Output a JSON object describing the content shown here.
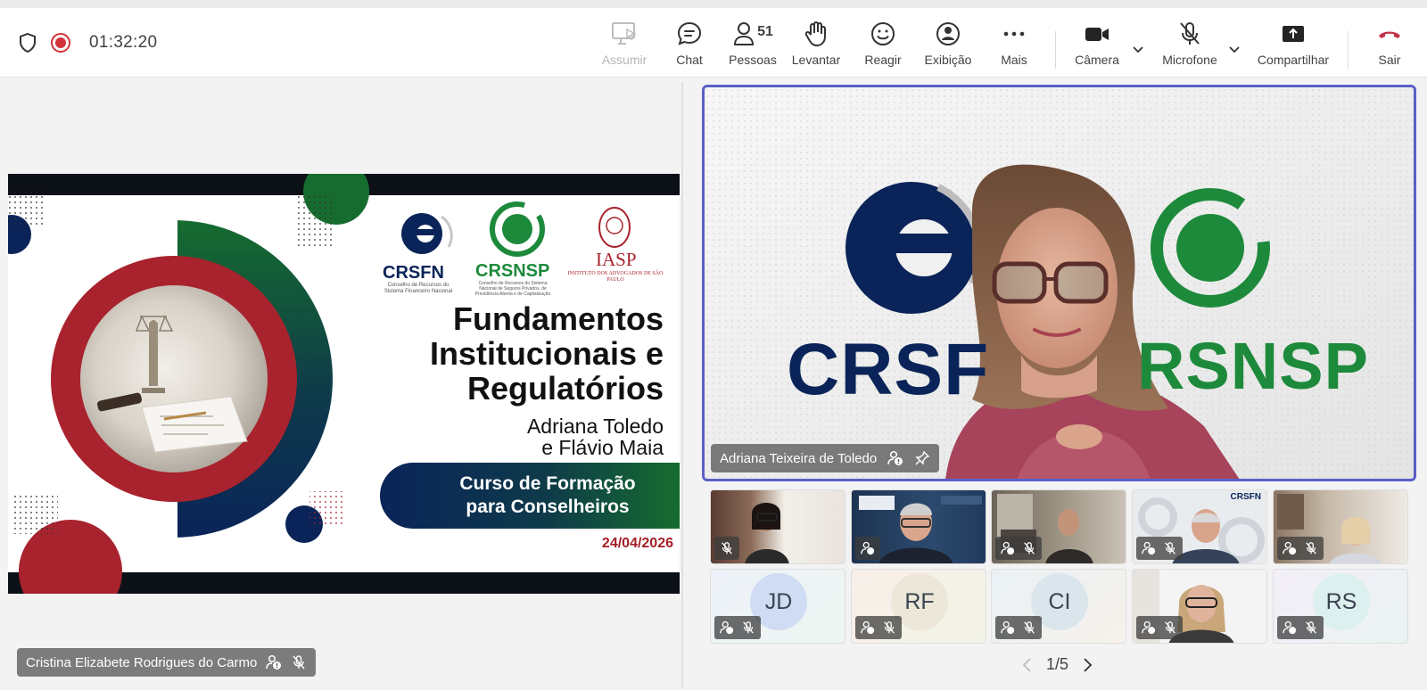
{
  "toolbar": {
    "timer": "01:32:20",
    "assumir": "Assumir",
    "chat": "Chat",
    "pessoas": "Pessoas",
    "pessoas_count": "51",
    "levantar": "Levantar",
    "reagir": "Reagir",
    "exibicao": "Exibição",
    "mais": "Mais",
    "camera": "Câmera",
    "microfone": "Microfone",
    "compartilhar": "Compartilhar",
    "sair": "Sair",
    "leave_color": "#c4314b",
    "record_color": "#d13438"
  },
  "slide": {
    "logo1": "CRSFN",
    "logo1_sub": "Conselho de Recursos do Sistema Financeiro Nacional",
    "logo2": "CRSNSP",
    "logo2_sub": "Conselho de Recursos do Sistema Nacional de Seguros Privados, de Previdência Aberta e de Capitalização",
    "logo3": "IASP",
    "logo3_sub": "INSTITUTO DOS ADVOGADOS DE SÃO PAULO",
    "title_line1": "Fundamentos",
    "title_line2": "Institucionais e",
    "title_line3": "Regulatórios",
    "authors_line1": "Adriana Toledo",
    "authors_line2": "e Flávio Maia",
    "course_line1": "Curso de Formação",
    "course_line2": "para Conselheiros",
    "date": "24/04/2026",
    "colors": {
      "red": "#a8232d",
      "green": "#166c2f",
      "navy": "#0a2459"
    }
  },
  "presenter_name": "Cristina Elizabete Rodrigues do Carmo",
  "speaker": {
    "name": "Adriana Teixeira de Toledo",
    "bg_text1": "CRSF",
    "bg_text2": "RSNSP",
    "border_color": "#5b5fc7"
  },
  "thumbs": {
    "t5_logo": "CRSFN",
    "jd": "JD",
    "rf": "RF",
    "ci": "CI",
    "rs": "RS"
  },
  "pager": "1/5"
}
